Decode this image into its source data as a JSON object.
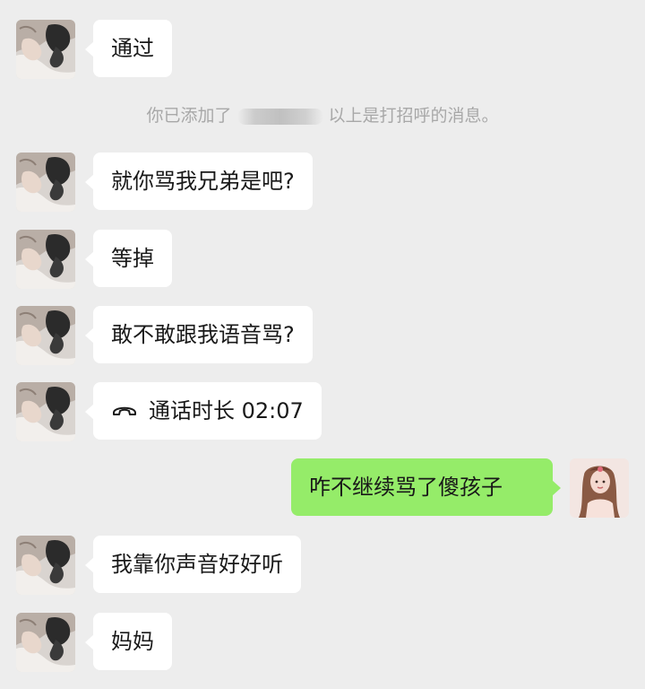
{
  "messages": [
    {
      "direction": "in",
      "text": "通过"
    },
    {
      "direction": "in",
      "text": "就你骂我兄弟是吧?"
    },
    {
      "direction": "in",
      "text": "等掉"
    },
    {
      "direction": "in",
      "text": "敢不敢跟我语音骂?"
    },
    {
      "direction": "in",
      "type": "call",
      "icon": "phone-hangup-icon",
      "text": "通话时长 02:07"
    },
    {
      "direction": "out",
      "text": "咋不继续骂了傻孩子"
    },
    {
      "direction": "in",
      "text": "我靠你声音好好听"
    },
    {
      "direction": "in",
      "text": "妈妈"
    }
  ],
  "system_notice": {
    "prefix": "你已添加了",
    "redacted_name": "",
    "suffix": "以上是打招呼的消息。"
  },
  "colors": {
    "background": "#ededed",
    "incoming_bubble": "#ffffff",
    "outgoing_bubble": "#95ec69",
    "system_text": "#a8a8a8"
  }
}
